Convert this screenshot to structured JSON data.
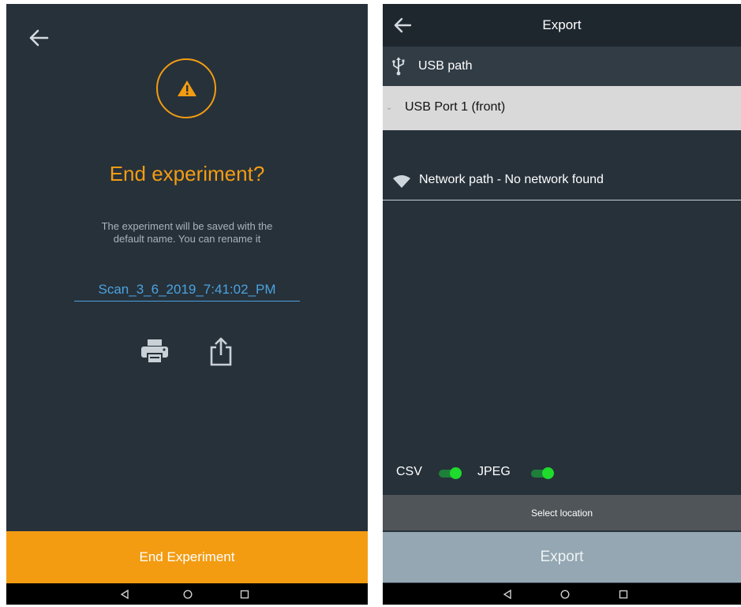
{
  "left": {
    "title": "End experiment?",
    "message": "The experiment will be saved with the default name. You can rename it",
    "experiment_name": "Scan_3_6_2019_7:41:02_PM",
    "end_button_label": "End Experiment",
    "icons": {
      "back": "arrow-left-icon",
      "warning": "warning-icon",
      "print": "print-icon",
      "share": "share-icon"
    }
  },
  "right": {
    "title": "Export",
    "usb_label": "USB path",
    "usb_selected": "USB Port 1 (front)",
    "network_label": "Network path - No network found",
    "toggles": [
      {
        "label": "CSV",
        "on": true
      },
      {
        "label": "JPEG",
        "on": true
      }
    ],
    "select_location_label": "Select location",
    "export_button_label": "Export",
    "icons": {
      "back": "arrow-left-icon",
      "usb": "usb-icon",
      "wifi": "wifi-icon"
    }
  },
  "nav": {
    "back": "◁",
    "home": "○",
    "recent": "□"
  },
  "colors": {
    "accent": "#f39c12",
    "link": "#4aa3df",
    "background": "#27313a",
    "toggle_on": "#1edb2c"
  }
}
